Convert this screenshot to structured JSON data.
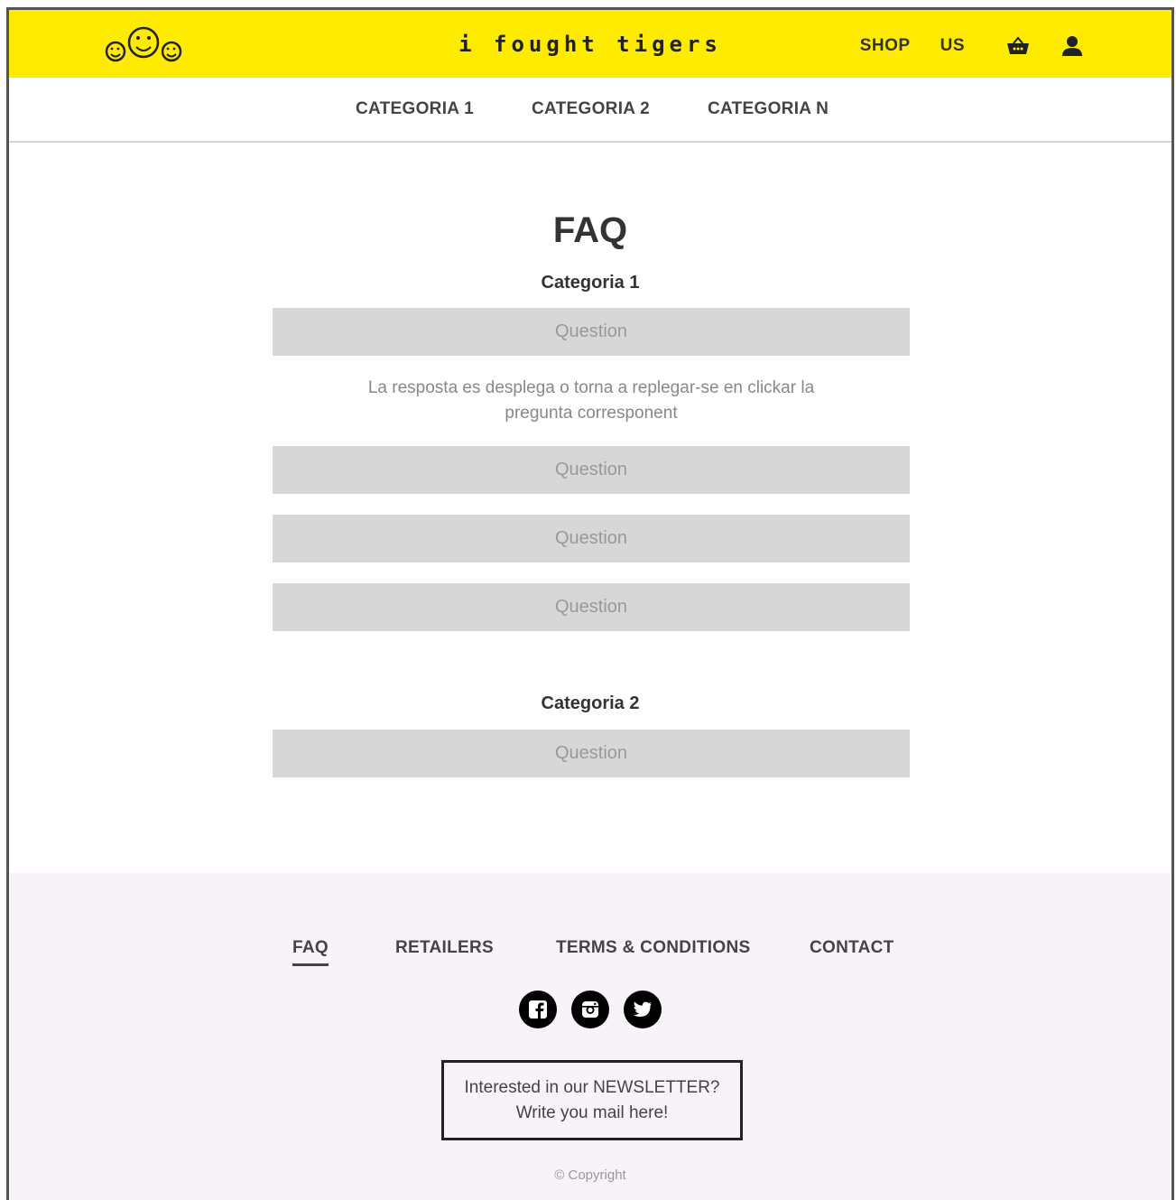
{
  "header": {
    "brand": "i fought tigers",
    "nav": {
      "shop": "SHOP",
      "us": "US"
    },
    "icons": {
      "logo": "smiley-faces-logo",
      "cart": "basket-icon",
      "account": "user-icon"
    },
    "accent_color": "#ffeb00"
  },
  "categories": [
    "CATEGORIA 1",
    "CATEGORIA 2",
    "CATEGORIA N"
  ],
  "main": {
    "title": "FAQ",
    "sections": [
      {
        "title": "Categoria 1",
        "questions": [
          "Question",
          "Question",
          "Question",
          "Question"
        ],
        "answer": "La resposta es desplega o torna a replegar-se en clickar la pregunta corresponent"
      },
      {
        "title": "Categoria 2",
        "questions": [
          "Question"
        ]
      }
    ]
  },
  "footer": {
    "links": [
      "FAQ",
      "RETAILERS",
      "TERMS & CONDITIONS",
      "CONTACT"
    ],
    "social_icons": [
      "facebook-icon",
      "instagram-icon",
      "twitter-icon"
    ],
    "newsletter": {
      "line1": "Interested in our NEWSLETTER?",
      "line2": "Write you mail here!"
    },
    "copyright": "© Copyright",
    "background": "#f8f2f9"
  }
}
